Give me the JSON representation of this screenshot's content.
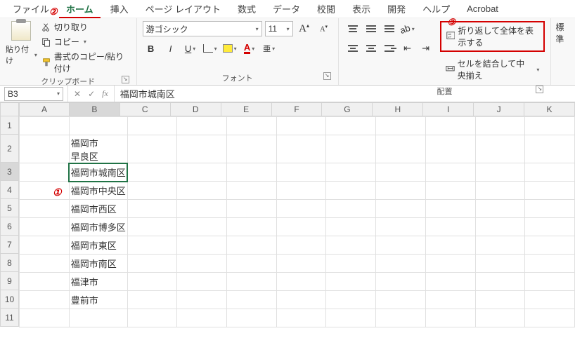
{
  "menu": {
    "file": "ファイル",
    "home": "ホーム",
    "insert": "挿入",
    "pagelayout": "ページ レイアウト",
    "formulas": "数式",
    "data": "データ",
    "review": "校閲",
    "view": "表示",
    "developer": "開発",
    "help": "ヘルプ",
    "acrobat": "Acrobat"
  },
  "clipboard": {
    "paste": "貼り付け",
    "cut": "切り取り",
    "copy": "コピー",
    "formatpainter": "書式のコピー/貼り付け",
    "group": "クリップボード"
  },
  "font": {
    "name": "游ゴシック",
    "size": "11",
    "group": "フォント"
  },
  "align": {
    "wrap": "折り返して全体を表示する",
    "merge": "セルを結合して中央揃え",
    "group": "配置"
  },
  "number": {
    "label": "標準"
  },
  "annotations": {
    "a1": "①",
    "a2": "②",
    "a3": "③"
  },
  "namebox": "B3",
  "formula_value": "福岡市城南区",
  "columns": [
    "A",
    "B",
    "C",
    "D",
    "E",
    "F",
    "G",
    "H",
    "I",
    "J",
    "K"
  ],
  "rows": [
    "1",
    "2",
    "3",
    "4",
    "5",
    "6",
    "7",
    "8",
    "9",
    "10",
    "11"
  ],
  "cells": {
    "B2": "福岡市\n早良区",
    "B3": "福岡市城南区",
    "B4": "福岡市中央区",
    "B5": "福岡市西区",
    "B6": "福岡市博多区",
    "B7": "福岡市東区",
    "B8": "福岡市南区",
    "B9": "福津市",
    "B10": "豊前市"
  }
}
